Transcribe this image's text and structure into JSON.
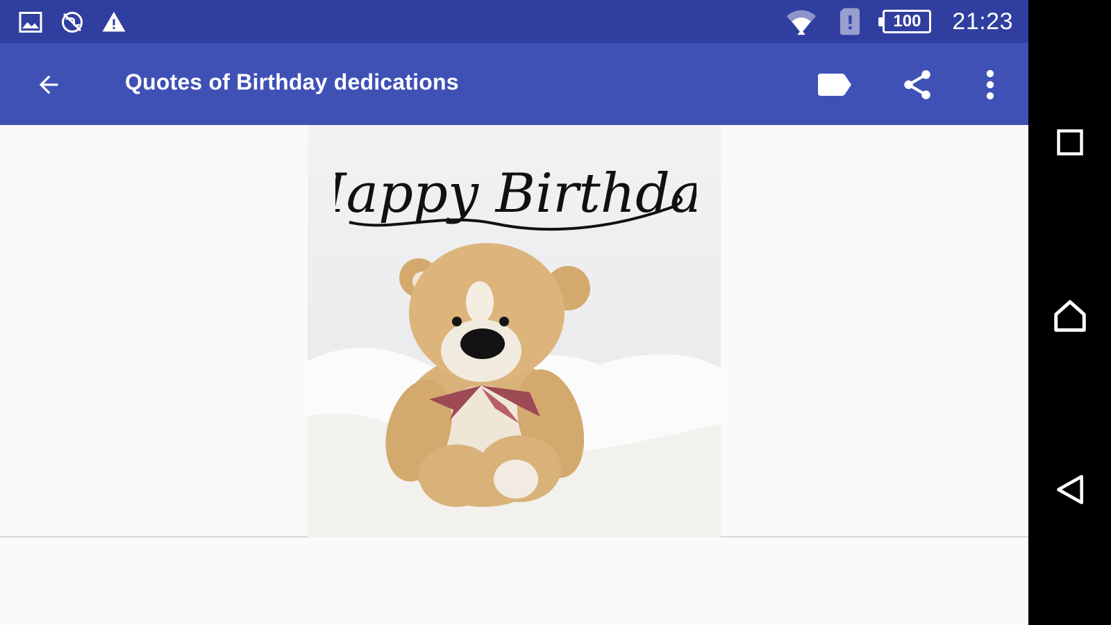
{
  "status_bar": {
    "left_icons": [
      "image-icon",
      "no-location-icon",
      "warning-icon"
    ],
    "battery_level": "100",
    "time": "21:23"
  },
  "toolbar": {
    "title": "Quotes of Birthday dedications",
    "back_icon": "arrow-back-icon",
    "actions": [
      "label-icon",
      "share-icon",
      "more-vert-icon"
    ]
  },
  "content": {
    "image_text": "Happy Birthday"
  },
  "nav_bar": {
    "buttons": [
      "recents-icon",
      "home-icon",
      "back-triangle-icon"
    ]
  },
  "colors": {
    "status_bar": "#303f9f",
    "toolbar": "#3f51b5",
    "background": "#fafafa",
    "nav_bar": "#000000"
  }
}
